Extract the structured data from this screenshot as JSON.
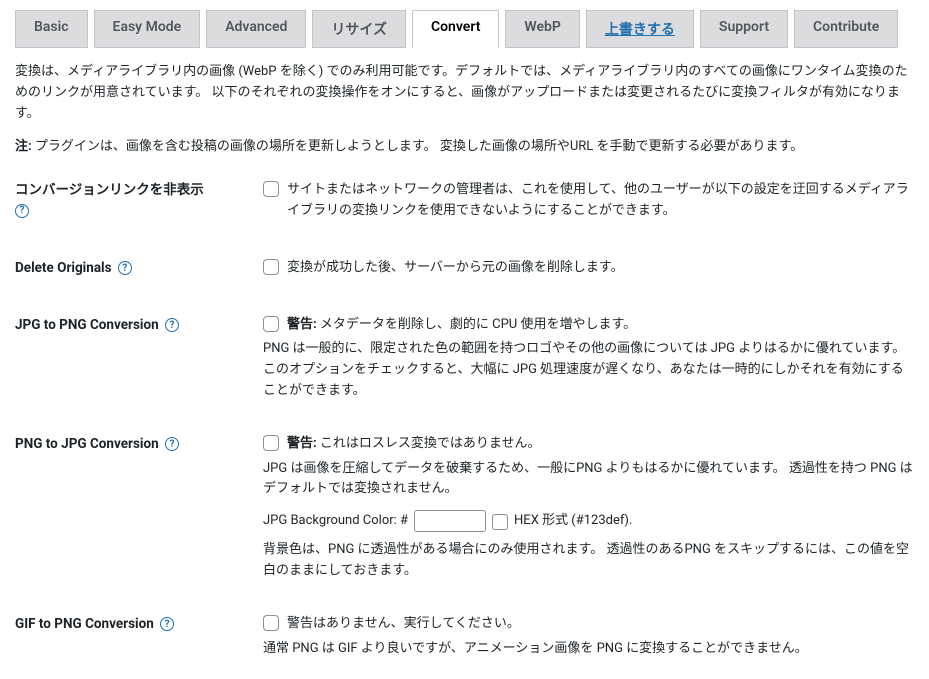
{
  "tabs": {
    "basic": "Basic",
    "easy": "Easy Mode",
    "advanced": "Advanced",
    "resize": "リサイズ",
    "convert": "Convert",
    "webp": "WebP",
    "overwrite": "上書きする",
    "support": "Support",
    "contribute": "Contribute"
  },
  "intro": "変換は、メディアライブラリ内の画像 (WebP を除く) でのみ利用可能です。デフォルトでは、メディアライブラリ内のすべての画像にワンタイム変換のためのリンクが用意されています。 以下のそれぞれの変換操作をオンにすると、画像がアップロードまたは変更されるたびに変換フィルタが有効になります。",
  "note_label": "注:",
  "note_text": " プラグインは、画像を含む投稿の画像の場所を更新しようとします。 変換した画像の場所やURL を手動で更新する必要があります。",
  "rows": {
    "hide_links": {
      "label": "コンバージョンリンクを非表示",
      "cb_text": "サイトまたはネットワークの管理者は、これを使用して、他のユーザーが以下の設定を迂回するメディアライブラリの変換リンクを使用できないようにすることができます。"
    },
    "delete_originals": {
      "label": "Delete Originals",
      "cb_text": "変換が成功した後、サーバーから元の画像を削除します。"
    },
    "jpg_to_png": {
      "label": "JPG to PNG Conversion",
      "warn_label": "警告:",
      "warn_text": " メタデータを削除し、劇的に CPU 使用を増やします。",
      "desc": "PNG は一般的に、限定された色の範囲を持つロゴやその他の画像については JPG よりはるかに優れています。 このオプションをチェックすると、大幅に JPG 処理速度が遅くなり、あなたは一時的にしかそれを有効にすることができます。"
    },
    "png_to_jpg": {
      "label": "PNG to JPG Conversion",
      "warn_label": "警告:",
      "warn_text": " これはロスレス変換ではありません。",
      "desc": "JPG は画像を圧縮してデータを破棄するため、一般にPNG よりもはるかに優れています。 透過性を持つ PNG はデフォルトでは変換されません。",
      "bgcolor_label": "JPG Background Color: #",
      "bgcolor_value": "",
      "hex_label": " HEX 形式 (#123def).",
      "bgcolor_desc": "背景色は、PNG に透過性がある場合にのみ使用されます。 透過性のあるPNG をスキップするには、この値を空白のままにしておきます。"
    },
    "gif_to_png": {
      "label": "GIF to PNG Conversion",
      "cb_text": "警告はありません、実行してください。",
      "desc": "通常 PNG は GIF より良いですが、アニメーション画像を PNG に変換することができません。"
    }
  }
}
